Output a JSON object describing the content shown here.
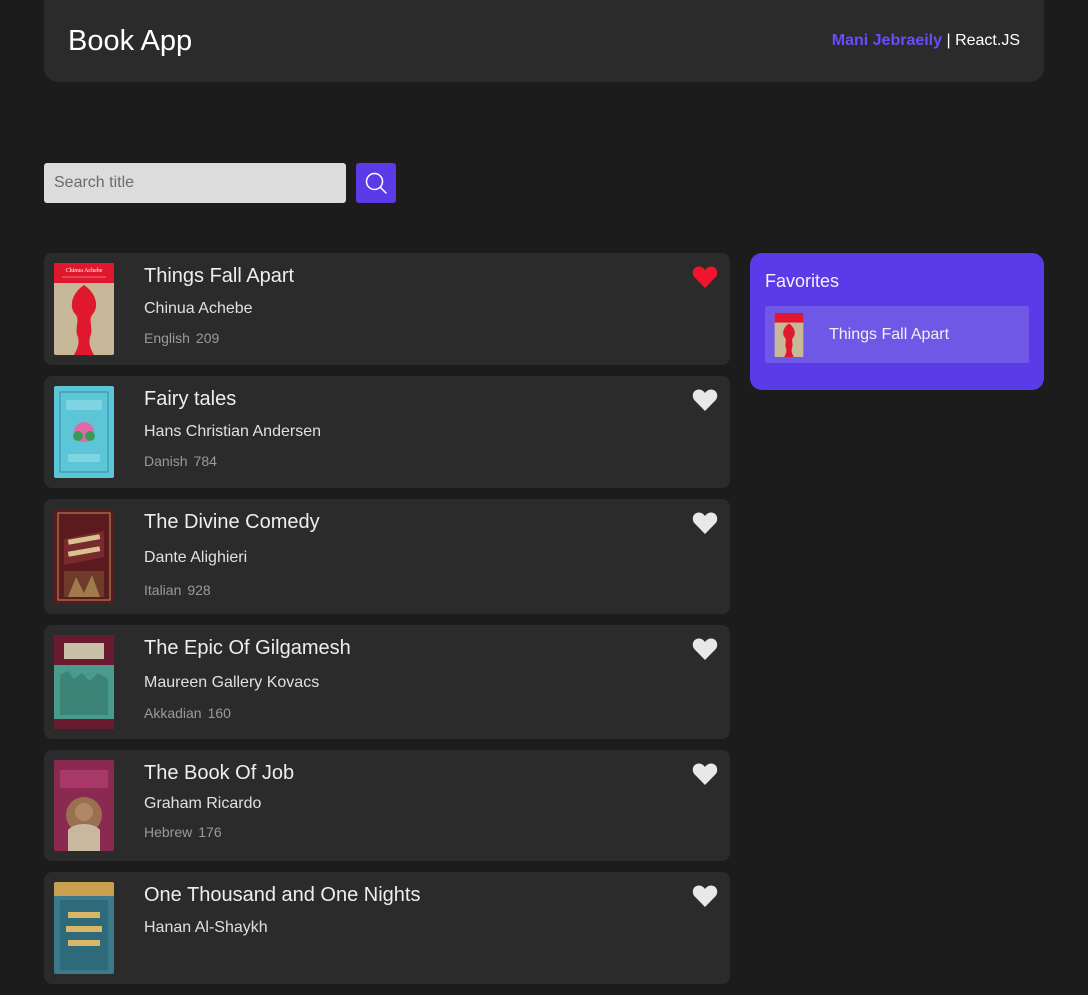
{
  "header": {
    "title": "Book App",
    "author": "Mani Jebraeily",
    "separator": " | ",
    "tech": "React.JS"
  },
  "search": {
    "placeholder": "Search title",
    "value": "",
    "button_icon": "search-icon"
  },
  "books": [
    {
      "title": "Things Fall Apart",
      "author": "Chinua Achebe",
      "language": "English",
      "pages": "209",
      "favorite": true,
      "cover_text": "Chinua Achebe"
    },
    {
      "title": "Fairy tales",
      "author": "Hans Christian Andersen",
      "language": "Danish",
      "pages": "784",
      "favorite": false
    },
    {
      "title": "The Divine Comedy",
      "author": "Dante Alighieri",
      "language": "Italian",
      "pages": "928",
      "favorite": false
    },
    {
      "title": "The Epic Of Gilgamesh",
      "author": "Maureen Gallery Kovacs",
      "language": "Akkadian",
      "pages": "160",
      "favorite": false
    },
    {
      "title": "The Book Of Job",
      "author": "Graham Ricardo",
      "language": "Hebrew",
      "pages": "176",
      "favorite": false
    },
    {
      "title": "One Thousand and One Nights",
      "author": "Hanan Al-Shaykh",
      "language": "",
      "pages": "",
      "favorite": false
    }
  ],
  "favorites": {
    "heading": "Favorites",
    "items": [
      {
        "title": "Things Fall Apart"
      }
    ]
  },
  "colors": {
    "accent": "#5b3be8",
    "heart_active": "#f0142c",
    "heart_inactive": "#e8e8e8",
    "background": "#1c1c1c",
    "card": "#2b2b2b"
  }
}
